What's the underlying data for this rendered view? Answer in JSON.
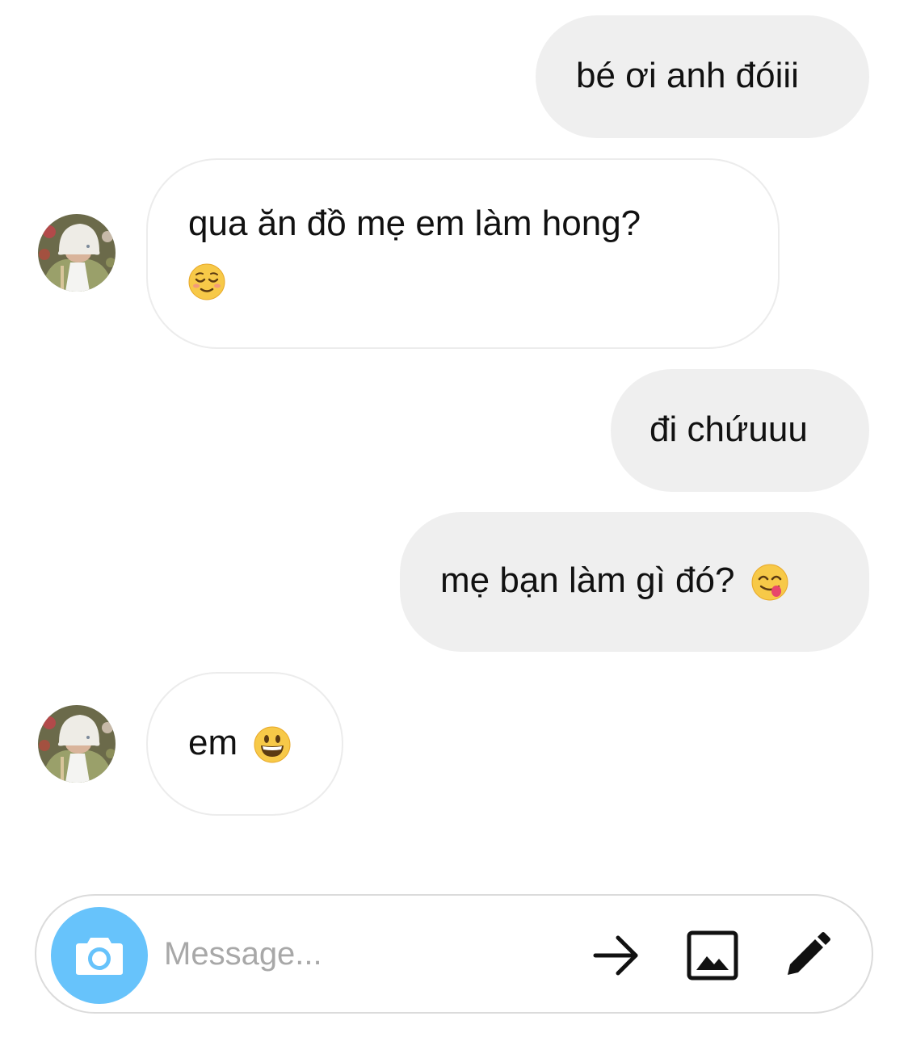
{
  "messages": [
    {
      "from": "me",
      "text": "bé ơi anh đóiii",
      "emoji": ""
    },
    {
      "from": "them",
      "text": "qua ăn đồ mẹ em làm hong?",
      "emoji": "relieved-face"
    },
    {
      "from": "me",
      "text": "đi chứuuu",
      "emoji": ""
    },
    {
      "from": "me",
      "text": "mẹ bạn làm gì đó?",
      "emoji": "face-savoring-food"
    },
    {
      "from": "them",
      "text": "em",
      "emoji": "grinning-face"
    }
  ],
  "composer": {
    "placeholder": "Message...",
    "camera_icon": "camera-icon",
    "send_icon": "arrow-right-icon",
    "gallery_icon": "image-icon",
    "draw_icon": "pencil-icon"
  },
  "colors": {
    "sent_bubble": "#efefef",
    "received_border": "#ececec",
    "camera_button": "#67c3fb",
    "placeholder": "#a8a8a8"
  }
}
